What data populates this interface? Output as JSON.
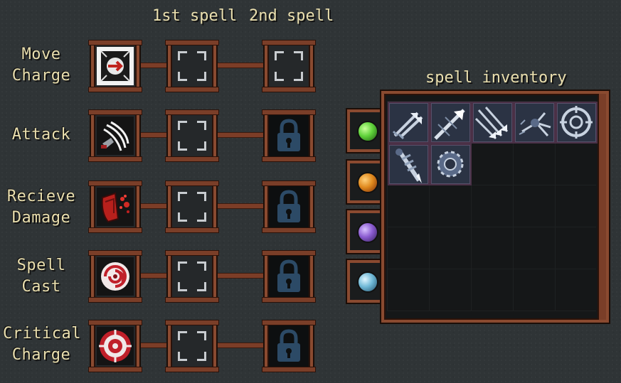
{
  "headers": {
    "first": "1st spell",
    "second": "2nd spell"
  },
  "rows": [
    {
      "line1": "Move",
      "line2": "Charge",
      "icon": "dash-arrow-icon",
      "second_locked": false
    },
    {
      "line1": "Attack",
      "line2": "",
      "icon": "claw-slash-icon",
      "second_locked": true
    },
    {
      "line1": "Recieve",
      "line2": "Damage",
      "icon": "shield-blood-icon",
      "second_locked": true
    },
    {
      "line1": "Spell",
      "line2": "Cast",
      "icon": "swirl-icon",
      "second_locked": true
    },
    {
      "line1": "Critical",
      "line2": "Charge",
      "icon": "crosshair-target-icon",
      "second_locked": true
    }
  ],
  "inventory": {
    "title": "spell inventory",
    "items": [
      "double-arrow-icon",
      "piercing-arrow-icon",
      "arrow-volley-icon",
      "scatter-arrow-icon",
      "target-reticle-icon",
      "drill-icon",
      "gear-saw-icon"
    ],
    "tabs": [
      {
        "name": "green-orb-tab",
        "color": "#5fd23a"
      },
      {
        "name": "orange-orb-tab",
        "color": "#e08a1e"
      },
      {
        "name": "purple-orb-tab",
        "color": "#8a5bd0"
      },
      {
        "name": "blue-orb-tab",
        "color": "#6fb8d6"
      }
    ]
  }
}
